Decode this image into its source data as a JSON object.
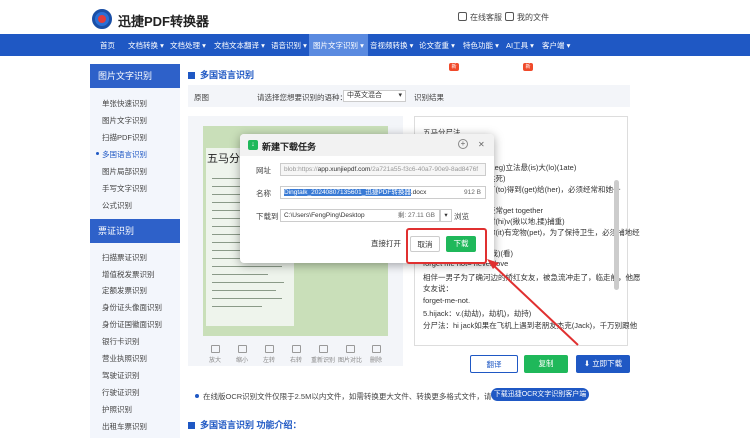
{
  "header": {
    "brand": "迅捷PDF转换器",
    "links": [
      "在线客服",
      "我的文件"
    ]
  },
  "nav": {
    "items": [
      "首页",
      "文档转换",
      "文档处理",
      "文档文本翻译",
      "语音识别",
      "图片文字识别",
      "音视频转换",
      "论文查重",
      "特色功能",
      "AI工具",
      "客户端"
    ],
    "badges": {
      "论文查重": "新",
      "AI工具": "新"
    }
  },
  "sidebar": {
    "section1_title": "图片文字识别",
    "section1_items": [
      "单张快速识别",
      "图片文字识别",
      "扫描PDF识别",
      "多国语言识别",
      "图片局部识别",
      "手写文字识别",
      "公式识别"
    ],
    "section2_title": "票证识别",
    "section2_items": [
      "扫描票证识别",
      "增值税发票识别",
      "定额发票识别",
      "身份证头像面识别",
      "身份证国徽面识别",
      "银行卡识别",
      "营业执照识别",
      "驾驶证识别",
      "行驶证识别",
      "护照识别",
      "出租车票识别"
    ]
  },
  "main": {
    "title": "多国语言识别",
    "original_label": "原图",
    "prompt": "请选择您想要识别的语种：",
    "language_selected": "中英文混合",
    "result_label": "识别结果",
    "image_title": "五马分尸",
    "tools": [
      "放大",
      "缩小",
      "左转",
      "右转",
      "重新识别",
      "图片对比",
      "删除"
    ],
    "buttons": {
      "translate": "翻译",
      "copy": "复制",
      "download": "立即下载"
    },
    "result_lines": [
      "五马分尸法",
      "(1eg)立法悬(is)大(lo)(1ate)",
      "共死)",
      "了(to)得到(get)给(her)，必须经常和她一",
      "经常get together",
      "对(hi)v(揪以地,揉)捕重)",
      "你(it)有宠物(pet)，为了保持卫生，必须捕地经",
      "(我)(看)",
      "forget me not= never love",
      "相伴一男子为了确河边的娇红女友，被急流冲走了，临走前，他愿",
      "女友说：",
      "forget-me-not.",
      "5.hijack：v.(劫劫)，劫机)，劫持)",
      "分尸法：hi jack如果在飞机上遇到老朋友杰克(Jack)，千万别跟他"
    ],
    "note": "在线版OCR识别文件仅限于2.5M以内文件，如需转换更大文件、转换更多格式文件，请",
    "note_button": "下载迅捷OCR文字识别客户端",
    "sub_title": "多国语言识别  功能介绍："
  },
  "dialog": {
    "title": "新建下载任务",
    "url_label": "网址",
    "url_prefix": "blob:https://",
    "url_domain": "app.xunjiepdf.com",
    "url_suffix": "/2a721a55-f3c6-40a7-90e9-8ad8476f",
    "name_label": "名称",
    "file_name": "Dingtalk_20240807135601_迅捷PDF转换器",
    "file_ext": ".docx",
    "file_size": "912 B",
    "save_label": "下载到",
    "save_path": "C:\\Users\\FengPing\\Desktop",
    "free_space": "剩: 27.11 GB",
    "browse": "浏览",
    "open_directly": "直接打开",
    "cancel": "取消",
    "download": "下载"
  },
  "colors": {
    "brand_blue": "#1f58c4",
    "sidebar_head": "#2e61c9",
    "green": "#1fb85a",
    "annotation_red": "#e03030"
  }
}
